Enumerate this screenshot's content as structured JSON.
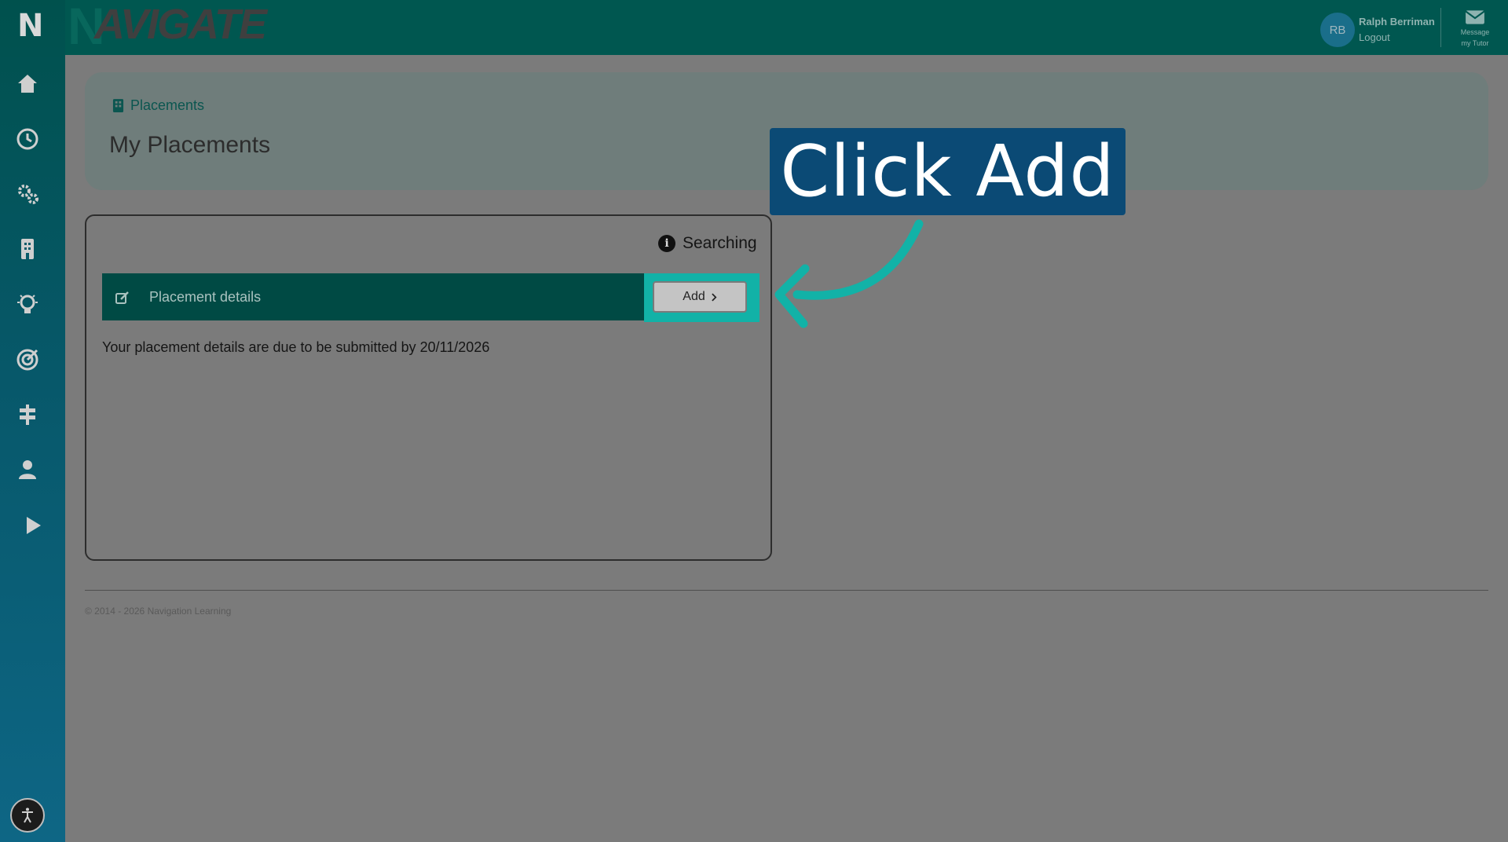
{
  "app": {
    "brand_mark": "N",
    "brand_name": "AVIGATE"
  },
  "user": {
    "initials": "RB",
    "name": "Ralph Berriman",
    "logout_label": "Logout",
    "message_label_line1": "Message",
    "message_label_line2": "my Tutor"
  },
  "sidebar": {
    "items": [
      {
        "icon": "home-icon"
      },
      {
        "icon": "clock-icon"
      },
      {
        "icon": "gears-icon"
      },
      {
        "icon": "building-icon"
      },
      {
        "icon": "lightbulb-icon"
      },
      {
        "icon": "target-icon"
      },
      {
        "icon": "signpost-icon"
      },
      {
        "icon": "user-icon"
      },
      {
        "icon": "play-icon"
      }
    ],
    "accessibility_icon": "accessibility-icon"
  },
  "page": {
    "breadcrumb": "Placements",
    "title": "My Placements"
  },
  "placement": {
    "status": "Searching",
    "details_label": "Placement details",
    "add_label": "Add",
    "due_text": "Your placement details are due to be submitted by 20/11/2026"
  },
  "footer": {
    "copyright": "© 2014 - 2026 Navigation Learning"
  },
  "callout": {
    "text": "Click Add"
  },
  "colors": {
    "primary": "#005750",
    "accent": "#12b2a7",
    "callout_bg": "#0b4a75"
  }
}
